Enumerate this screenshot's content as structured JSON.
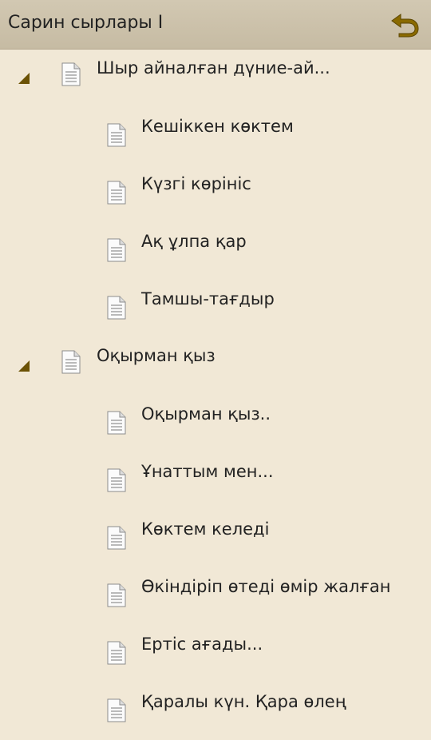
{
  "header": {
    "title": "Сарин сырлары І",
    "back_icon": "undo-arrow-icon"
  },
  "colors": {
    "background": "#f1e8d6",
    "header": "#c9bea6",
    "back_arrow": "#8a6a00",
    "expander": "#6b5205"
  },
  "tree": {
    "sections": [
      {
        "title": "Шыр айналған дүние-ай...",
        "expanded": true,
        "items": [
          {
            "title": "Кешіккен көктем"
          },
          {
            "title": "Күзгі көрініс"
          },
          {
            "title": "Ақ ұлпа қар"
          },
          {
            "title": "Тамшы-тағдыр"
          }
        ]
      },
      {
        "title": "Оқырман қыз",
        "expanded": true,
        "items": [
          {
            "title": "Оқырман қыз.."
          },
          {
            "title": "Ұнаттым мен..."
          },
          {
            "title": "Көктем келеді"
          },
          {
            "title": "Өкіндіріп өтеді өмір жалған"
          },
          {
            "title": "Ертіс ағады..."
          },
          {
            "title": "Қаралы күн. Қара өлең"
          }
        ]
      }
    ]
  }
}
